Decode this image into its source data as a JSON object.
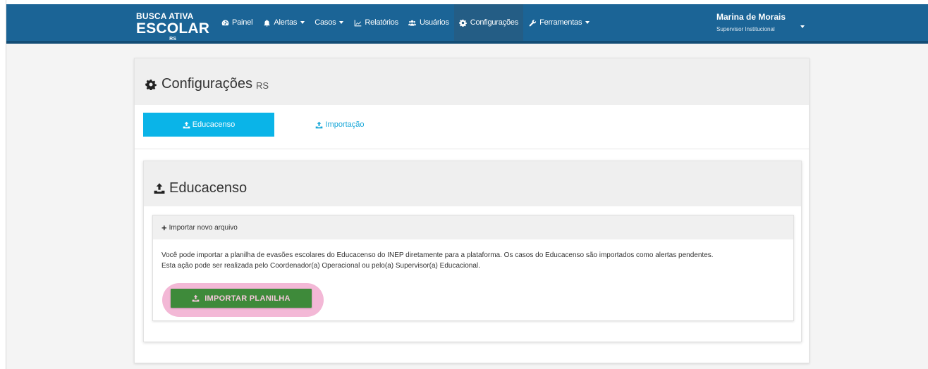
{
  "logo": {
    "line1": "BUSCA ATIVA",
    "line2": "ESCOLAR",
    "line3": "RS"
  },
  "nav": {
    "items": [
      {
        "label": "Painel",
        "icon": "dashboard-icon"
      },
      {
        "label": "Alertas",
        "icon": "bell-icon",
        "dropdown": true
      },
      {
        "label": "Casos",
        "dropdown": true
      },
      {
        "label": "Relatórios",
        "icon": "line-chart-icon"
      },
      {
        "label": "Usuários",
        "icon": "users-icon"
      },
      {
        "label": "Configurações",
        "icon": "gear-icon",
        "active": true
      },
      {
        "label": "Ferramentas",
        "icon": "wrench-icon",
        "dropdown": true
      }
    ]
  },
  "user": {
    "name": "Marina de Morais",
    "role": "Supervisor Institucional"
  },
  "page": {
    "title": "Configurações",
    "subtitle": "RS"
  },
  "tabs": [
    {
      "label": "Educacenso",
      "active": true
    },
    {
      "label": "Importação",
      "active": false
    }
  ],
  "section": {
    "title": "Educacenso",
    "box_header": "Importar novo arquivo",
    "description_line1": "Você pode importar a planilha de evasões escolares do Educacenso do INEP diretamente para a plataforma. Os casos do Educacenso são importados como alertas pendentes.",
    "description_line2": "Esta ação pode ser realizada pelo Coordenador(a) Operacional ou pelo(a) Supervisor(a) Educacional.",
    "button_label": "IMPORTAR PLANILHA"
  },
  "colors": {
    "navbar": "#1b6496",
    "active_tab": "#0ab4e8",
    "button": "#3e8a3a",
    "highlight": "#f3b8d6"
  }
}
